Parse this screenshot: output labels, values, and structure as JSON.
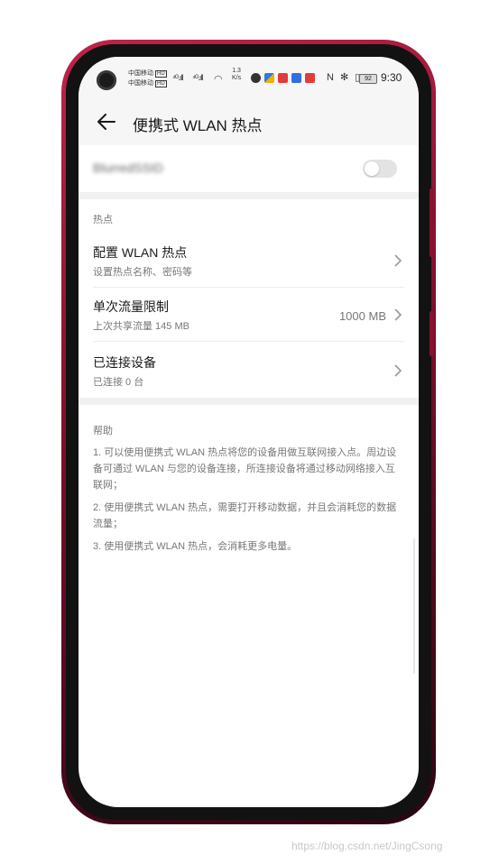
{
  "status_bar": {
    "carrier1": "中国移动",
    "carrier2": "中国移动",
    "hd_badge": "HD",
    "signal1": "⁴ᴳ.ıll",
    "signal2": "⁴ᴳ.ıll",
    "speed_top": "1.3",
    "speed_unit": "K/s",
    "icons_right": "N ✻ ▯",
    "battery": "92",
    "time": "9:30"
  },
  "header": {
    "back_icon": "arrow-left-icon",
    "title": "便携式 WLAN 热点"
  },
  "hotspot_toggle": {
    "label": "BlurredSSID",
    "enabled": false
  },
  "hotspot_section": {
    "label": "热点",
    "items": [
      {
        "title": "配置 WLAN 热点",
        "subtitle": "设置热点名称、密码等",
        "value": ""
      },
      {
        "title": "单次流量限制",
        "subtitle": "上次共享流量 145 MB",
        "value": "1000 MB"
      },
      {
        "title": "已连接设备",
        "subtitle": "已连接 0 台",
        "value": ""
      }
    ]
  },
  "help_section": {
    "label": "帮助",
    "paragraphs": [
      "1. 可以使用便携式 WLAN 热点将您的设备用做互联网接入点。周边设备可通过 WLAN 与您的设备连接，所连接设备将通过移动网络接入互联网；",
      "2. 使用便携式 WLAN 热点，需要打开移动数据，并且会消耗您的数据流量；",
      "3. 使用便携式 WLAN 热点，会消耗更多电量。"
    ]
  },
  "watermark": "https://blog.csdn.net/JingCsong",
  "colors": {
    "phone_frame": "#c0244a",
    "screen_bg": "#ffffff",
    "band": "#f1f1f1"
  }
}
